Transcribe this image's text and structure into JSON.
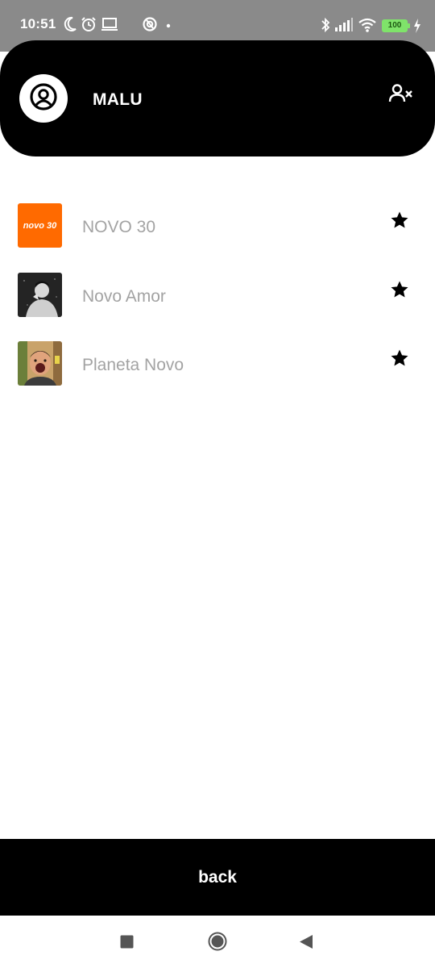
{
  "status_bar": {
    "time": "10:51",
    "battery": "100",
    "icons": [
      "moon-icon",
      "alarm-icon",
      "laptop-icon",
      "data-saver-icon",
      "dot-icon",
      "bluetooth-icon",
      "signal-icon",
      "wifi-icon",
      "battery-icon",
      "charging-icon"
    ]
  },
  "header": {
    "user_name": "MALU",
    "avatar_icon": "user-circle-icon",
    "action_icon": "remove-user-icon"
  },
  "favorites": {
    "items": [
      {
        "label": "NOVO 30",
        "thumb_text": "novo 30",
        "thumb_color": "#ff6a00",
        "starred": true
      },
      {
        "label": "Novo Amor",
        "starred": true
      },
      {
        "label": "Planeta Novo",
        "starred": true
      }
    ]
  },
  "footer": {
    "back_label": "back"
  },
  "nav": {
    "icons": [
      "recents-square-icon",
      "home-circle-icon",
      "back-triangle-icon"
    ]
  },
  "colors": {
    "header_bg": "#000000",
    "status_bg": "#8a8a8a",
    "item_text": "#a3a3a3",
    "accent_orange": "#ff6a00"
  }
}
